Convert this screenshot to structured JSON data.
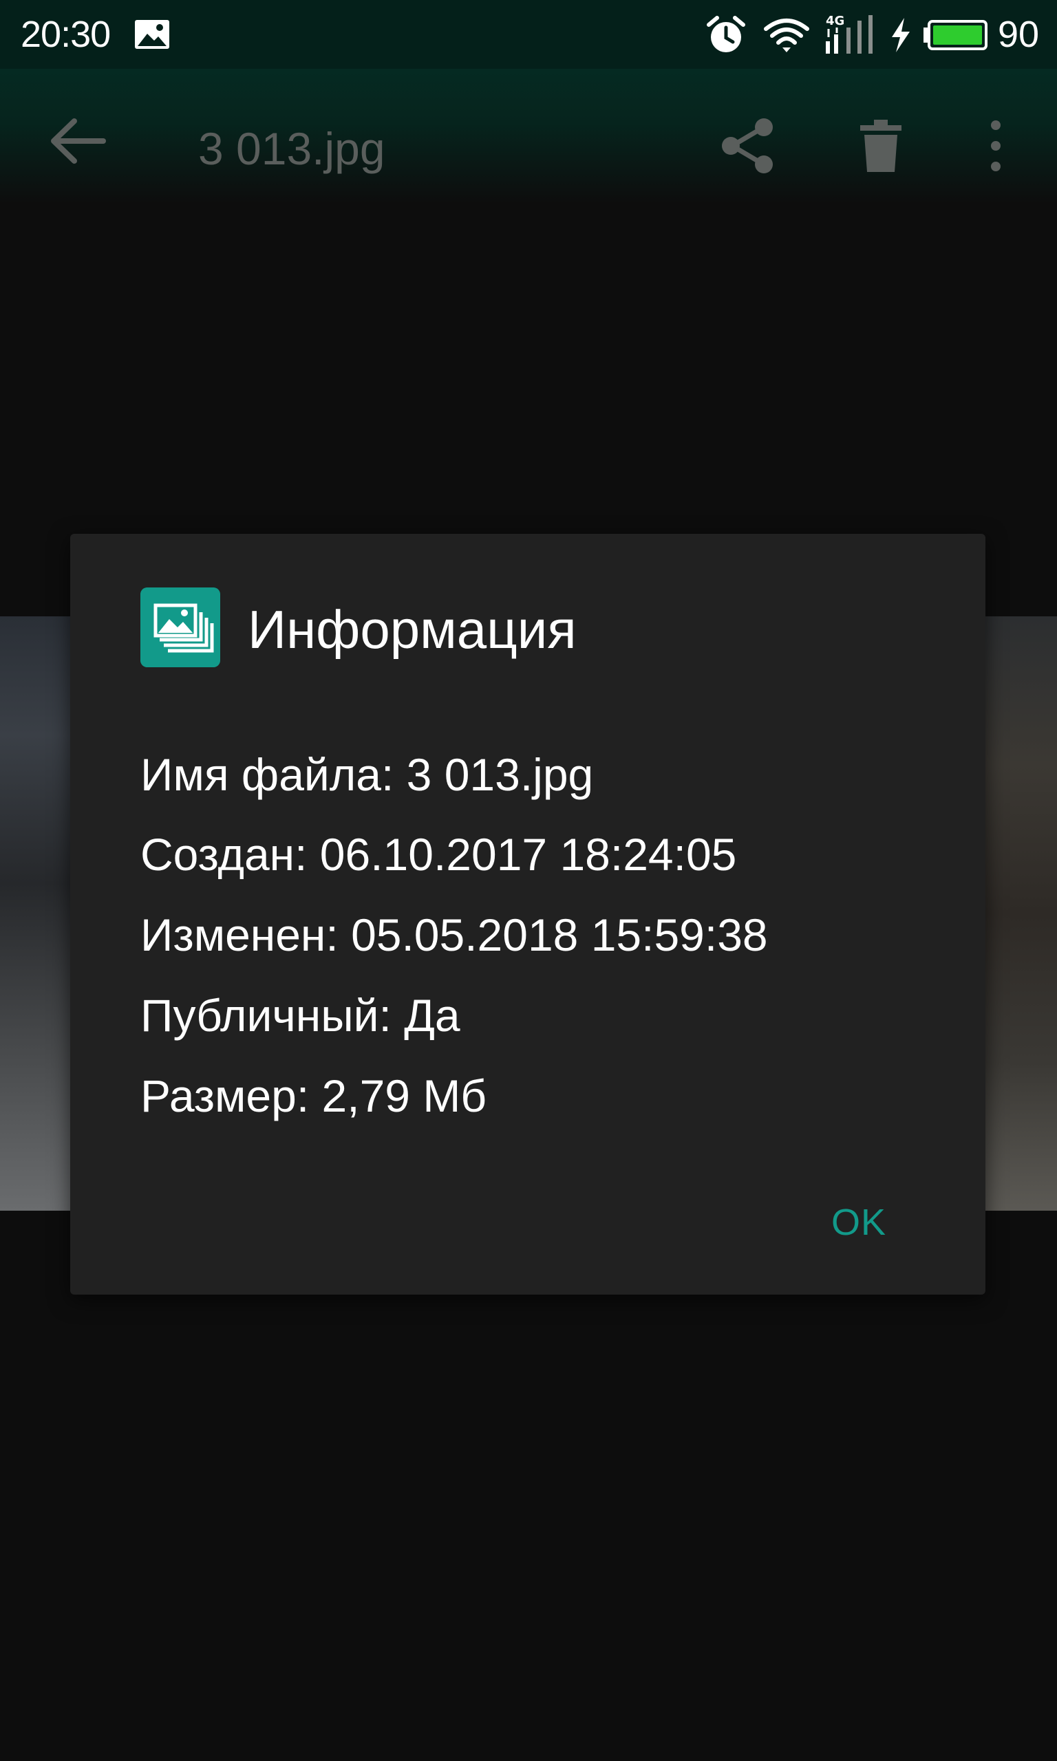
{
  "status_bar": {
    "time": "20:30",
    "network_label": "4G",
    "battery_level": "90",
    "icons": [
      "gallery-icon",
      "alarm-icon",
      "wifi-icon",
      "signal-icon",
      "charging-icon",
      "battery-icon"
    ],
    "battery_color": "#2ecc2e"
  },
  "toolbar": {
    "title": "3 013.jpg",
    "icons": [
      "back-arrow-icon",
      "share-icon",
      "delete-icon",
      "more-vert-icon"
    ]
  },
  "dialog": {
    "title": "Информация",
    "icon": "photos-stack-icon",
    "accent_color": "#129a8a",
    "lines": [
      {
        "label": "Имя файла:",
        "value": "3 013.jpg"
      },
      {
        "label": "Создан:",
        "value": "06.10.2017 18:24:05"
      },
      {
        "label": "Изменен:",
        "value": "05.05.2018 15:59:38"
      },
      {
        "label": "Публичный:",
        "value": "Да"
      },
      {
        "label": "Размер:",
        "value": "2,79 Мб"
      }
    ],
    "ok_label": "OK"
  }
}
